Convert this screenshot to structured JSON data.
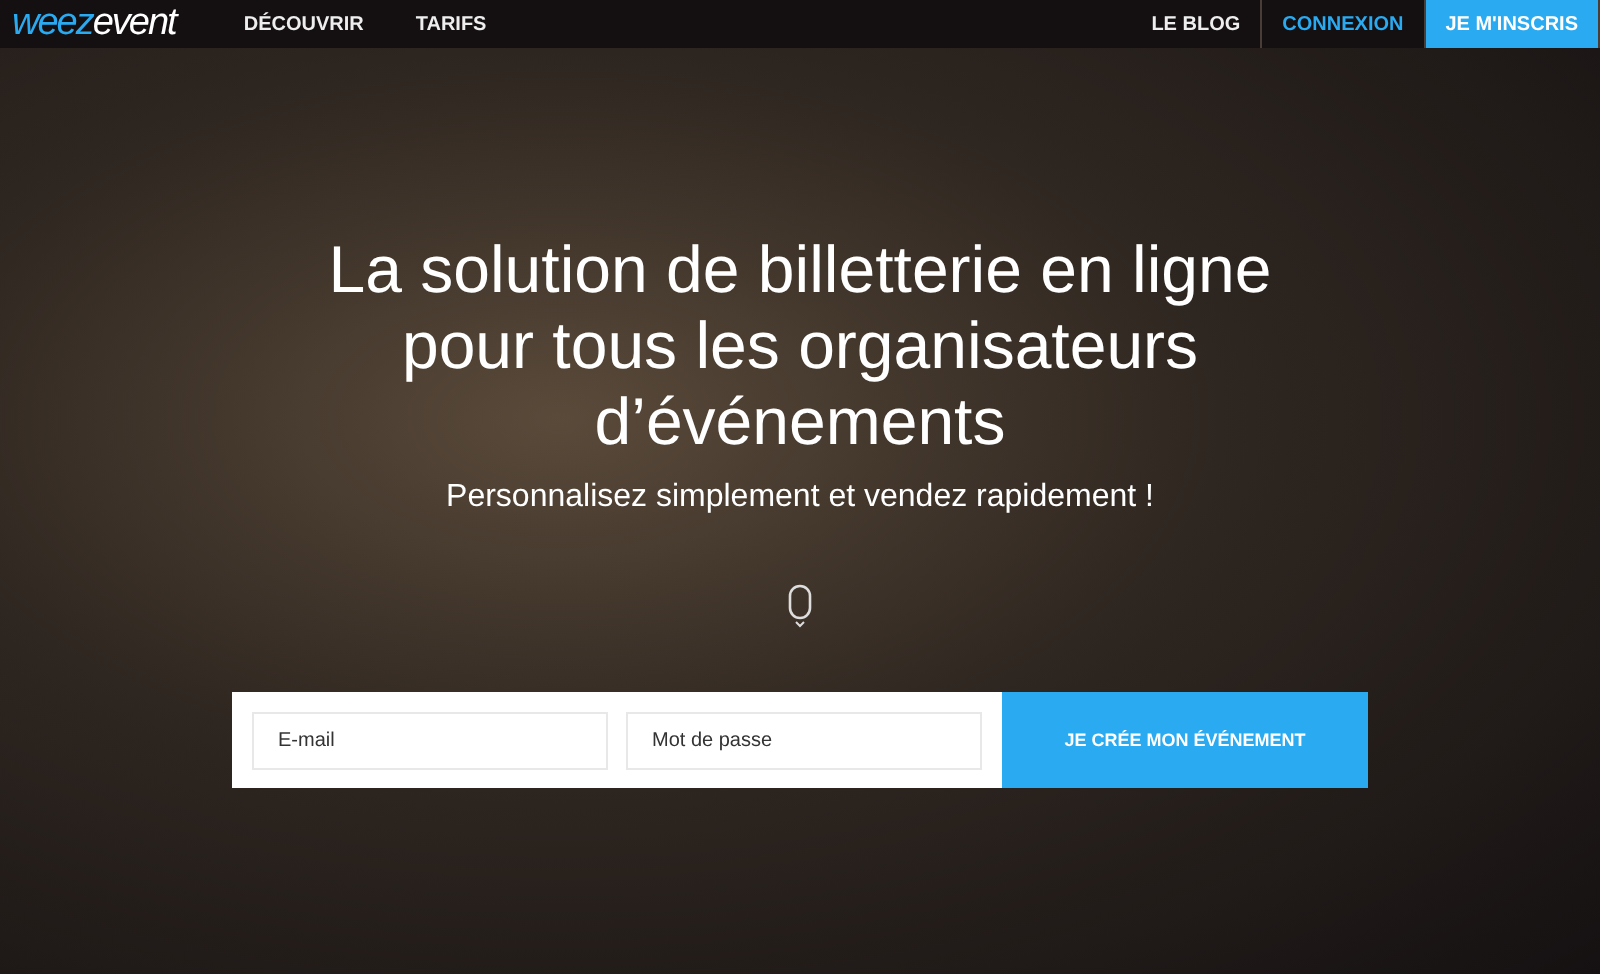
{
  "logo": {
    "accent": "weez",
    "rest": "event"
  },
  "nav_left": [
    "DÉCOUVRIR",
    "TARIFS"
  ],
  "nav_right": [
    {
      "label": "LE BLOG",
      "kind": "link"
    },
    {
      "label": "CONNEXION",
      "kind": "accent"
    },
    {
      "label": "JE M'INSCRIS",
      "kind": "cta"
    }
  ],
  "hero": {
    "title": "La solution de billetterie en ligne pour tous les organisateurs d’événements",
    "subtitle": "Personnalisez simplement et vendez rapidement !"
  },
  "form": {
    "email": {
      "placeholder": "E-mail"
    },
    "password": {
      "placeholder": "Mot de passe"
    },
    "submit": "JE CRÉE MON ÉVÉNEMENT"
  }
}
